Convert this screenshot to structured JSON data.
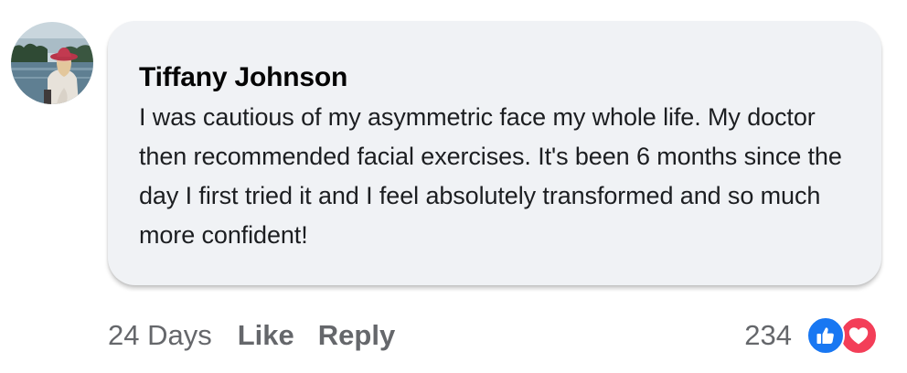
{
  "comment": {
    "author": "Tiffany Johnson",
    "text": "I was cautious of my asymmetric face my whole life. My doctor then recommended facial exercises. It's been 6 months since the day I first tried it and I feel absolutely transformed and so much more confident!",
    "avatar_icon": "profile-photo-woman-red-hat-lake"
  },
  "actions": {
    "timestamp": "24 Days",
    "like_label": "Like",
    "reply_label": "Reply"
  },
  "reactions": {
    "count": "234",
    "icons": [
      "like-thumbs-up-icon",
      "love-heart-icon"
    ],
    "colors": {
      "like": "#1877f2",
      "love": "#f33e58"
    }
  }
}
